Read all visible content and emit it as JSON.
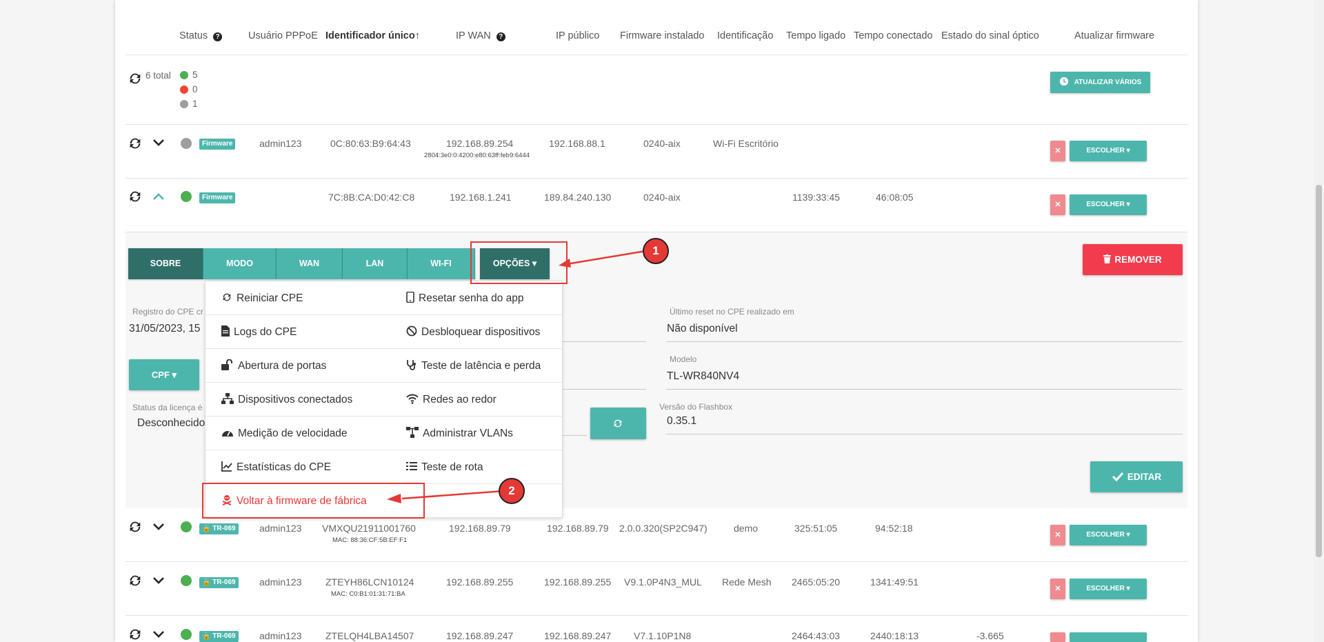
{
  "headers": {
    "status": "Status",
    "usuario": "Usuário PPPoE",
    "identificador": "Identificador único↑",
    "ip_wan": "IP WAN",
    "ip_publico": "IP público",
    "firmware": "Firmware instalado",
    "identificacao": "Identificação",
    "tempo_ligado": "Tempo ligado",
    "tempo_conectado": "Tempo conectado",
    "sinal_optico": "Estado do sinal óptico",
    "atualizar": "Atualizar firmware"
  },
  "summary": {
    "total": "6 total",
    "green": "5",
    "red": "0",
    "gray": "1",
    "update_many": "ATUALIZAR VÁRIOS"
  },
  "rows": [
    {
      "status": "gray",
      "badge": "Firmware",
      "user": "admin123",
      "id": "0C:80:63:B9:64:43",
      "ip_wan": "192.168.89.254",
      "ip_wan_sub": "2804:3e0:0:4200:e80:63ff:feb9:6444",
      "ip_pub": "192.168.88.1",
      "fw": "0240-aix",
      "ident": "Wi-Fi Escritório",
      "up": "",
      "conn": "",
      "signal": "",
      "choose": "ESCOLHER"
    },
    {
      "status": "green",
      "badge": "Firmware",
      "user": "",
      "id": "7C:8B:CA:D0:42:C8",
      "ip_wan": "192.168.1.241",
      "ip_pub": "189.84.240.130",
      "fw": "0240-aix",
      "ident": "",
      "up": "1139:33:45",
      "conn": "46:08:05",
      "signal": "",
      "choose": "ESCOLHER"
    },
    {
      "status": "green",
      "badge": "TR-069",
      "user": "admin123",
      "id": "VMXQU21911001760",
      "id_sub": "MAC: 88:36:CF:5B:EF:F1",
      "ip_wan": "192.168.89.79",
      "ip_pub": "192.168.89.79",
      "fw": "2.0.0.320(SP2C947)",
      "ident": "demo",
      "up": "325:51:05",
      "conn": "94:52:18",
      "signal": "",
      "choose": "ESCOLHER"
    },
    {
      "status": "green",
      "badge": "TR-069",
      "user": "admin123",
      "id": "ZTEYH86LCN10124",
      "id_sub": "MAC: C0:B1:01:31:71:BA",
      "ip_wan": "192.168.89.255",
      "ip_pub": "192.168.89.255",
      "fw": "V9.1.0P4N3_MUL",
      "ident": "Rede Mesh",
      "up": "2465:05:20",
      "conn": "1341:49:51",
      "signal": "",
      "choose": "ESCOLHER"
    },
    {
      "status": "green",
      "badge": "TR-069",
      "user": "admin123",
      "id": "ZTELQH4LBA14507",
      "ip_wan": "192.168.89.247",
      "ip_pub": "192.168.89.247",
      "fw": "V7.1.10P1N8",
      "ident": "",
      "up": "2464:43:03",
      "conn": "2440:18:13",
      "signal": "-3.665",
      "choose": "ESCOLHER"
    }
  ],
  "tabs": [
    "SOBRE",
    "MODO",
    "WAN",
    "LAN",
    "WI-FI",
    "OPÇÕES"
  ],
  "details": {
    "registro_label": "Registro do CPE cr",
    "registro_value": "31/05/2023, 15",
    "cpf_button": "CPF",
    "licenca_label": "Status da licença é",
    "licenca_value": "Desconhecido",
    "reset_label": "Último reset no CPE realizado em",
    "reset_value": "Não disponível",
    "modelo_label": "Modelo",
    "modelo_value": "TL-WR840NV4",
    "flashbox_label": "Versão do Flashbox",
    "flashbox_value": "0.35.1",
    "remove_button": "REMOVER",
    "edit_button": "EDITAR"
  },
  "menu": {
    "left": [
      "Reiniciar CPE",
      "Logs do CPE",
      "Abertura de portas",
      "Dispositivos conectados",
      "Medição de velocidade",
      "Estatísticas do CPE"
    ],
    "right": [
      "Resetar senha do app",
      "Desbloquear dispositivos",
      "Teste de latência e perda",
      "Redes ao redor",
      "Administrar VLANs",
      "Teste de rota"
    ],
    "factory": "Voltar à firmware de fábrica"
  },
  "callouts": [
    "1",
    "2"
  ],
  "colors": {
    "teal": "#4db6ac",
    "teal_dark": "#2f6f68",
    "green": "#4caf50",
    "red": "#f44336",
    "gray": "#9e9e9e",
    "remove": "#f23c4e",
    "annotation": "#e53935"
  }
}
